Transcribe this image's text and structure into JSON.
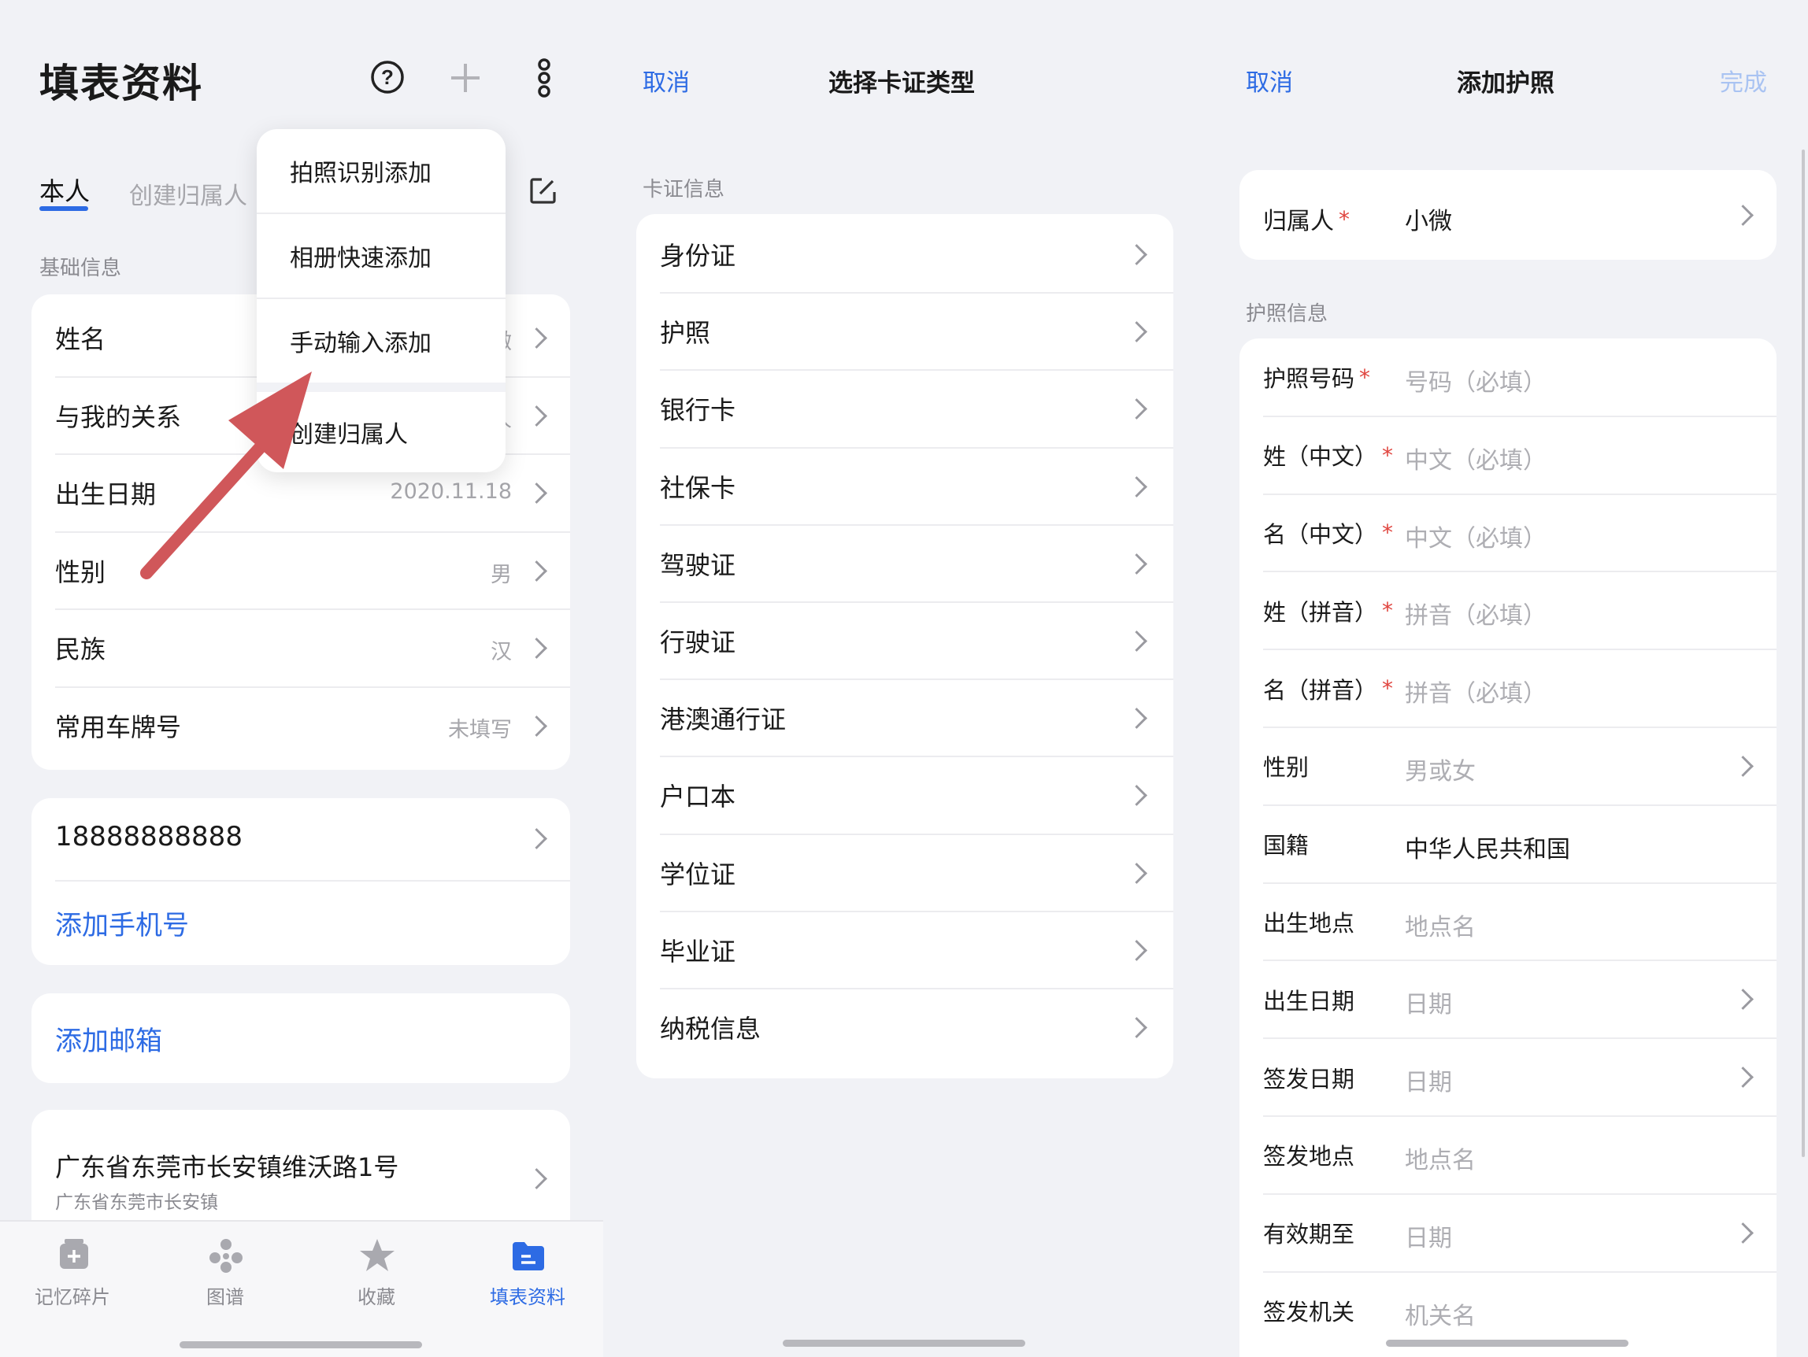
{
  "panel1": {
    "title": "填表资料",
    "top_icons": [
      "help-icon",
      "plus-icon",
      "more-icon"
    ],
    "tabs": {
      "active": "本人",
      "inactive": "创建归属人"
    },
    "basic_section": "基础信息",
    "basic_rows": [
      {
        "label": "姓名",
        "value": "小微"
      },
      {
        "label": "与我的关系",
        "value": "本人"
      },
      {
        "label": "出生日期",
        "value": "2020.11.18"
      },
      {
        "label": "性别",
        "value": "男"
      },
      {
        "label": "民族",
        "value": "汉"
      },
      {
        "label": "常用车牌号",
        "value": "未填写"
      }
    ],
    "phone": {
      "number": "18888888888",
      "add": "添加手机号"
    },
    "email": {
      "add": "添加邮箱"
    },
    "address": {
      "main": "广东省东莞市长安镇维沃路1号",
      "sub": "广东省东莞市长安镇"
    },
    "dropdown": [
      "拍照识别添加",
      "相册快速添加",
      "手动输入添加",
      "创建归属人"
    ],
    "bottom_nav": [
      {
        "label": "记忆碎片",
        "icon": "memory-icon",
        "active": false
      },
      {
        "label": "图谱",
        "icon": "graph-icon",
        "active": false
      },
      {
        "label": "收藏",
        "icon": "star-icon",
        "active": false
      },
      {
        "label": "填表资料",
        "icon": "folder-icon",
        "active": true
      }
    ]
  },
  "panel2": {
    "cancel": "取消",
    "title": "选择卡证类型",
    "section": "卡证信息",
    "items": [
      "身份证",
      "护照",
      "银行卡",
      "社保卡",
      "驾驶证",
      "行驶证",
      "港澳通行证",
      "户口本",
      "学位证",
      "毕业证",
      "纳税信息"
    ]
  },
  "panel3": {
    "cancel": "取消",
    "title": "添加护照",
    "done": "完成",
    "owner": {
      "label": "归属人",
      "required": "*",
      "value": "小微"
    },
    "section": "护照信息",
    "fields": [
      {
        "label": "护照号码",
        "required": "*",
        "placeholder": "号码（必填）",
        "chevron": false,
        "filled": false
      },
      {
        "label": "姓（中文）",
        "required": "*",
        "placeholder": "中文（必填）",
        "chevron": false,
        "filled": false
      },
      {
        "label": "名（中文）",
        "required": "*",
        "placeholder": "中文（必填）",
        "chevron": false,
        "filled": false
      },
      {
        "label": "姓（拼音）",
        "required": "*",
        "placeholder": "拼音（必填）",
        "chevron": false,
        "filled": false
      },
      {
        "label": "名（拼音）",
        "required": "*",
        "placeholder": "拼音（必填）",
        "chevron": false,
        "filled": false
      },
      {
        "label": "性别",
        "required": "",
        "placeholder": "男或女",
        "chevron": true,
        "filled": false
      },
      {
        "label": "国籍",
        "required": "",
        "placeholder": "中华人民共和国",
        "chevron": false,
        "filled": true
      },
      {
        "label": "出生地点",
        "required": "",
        "placeholder": "地点名",
        "chevron": false,
        "filled": false
      },
      {
        "label": "出生日期",
        "required": "",
        "placeholder": "日期",
        "chevron": true,
        "filled": false
      },
      {
        "label": "签发日期",
        "required": "",
        "placeholder": "日期",
        "chevron": true,
        "filled": false
      },
      {
        "label": "签发地点",
        "required": "",
        "placeholder": "地点名",
        "chevron": false,
        "filled": false
      },
      {
        "label": "有效期至",
        "required": "",
        "placeholder": "日期",
        "chevron": true,
        "filled": false
      },
      {
        "label": "签发机关",
        "required": "",
        "placeholder": "机关名",
        "chevron": false,
        "filled": false
      }
    ]
  },
  "colors": {
    "accent": "#2d6be4",
    "background": "#f1f2f6",
    "arrow": "#d0575a",
    "required": "#e0453f"
  }
}
